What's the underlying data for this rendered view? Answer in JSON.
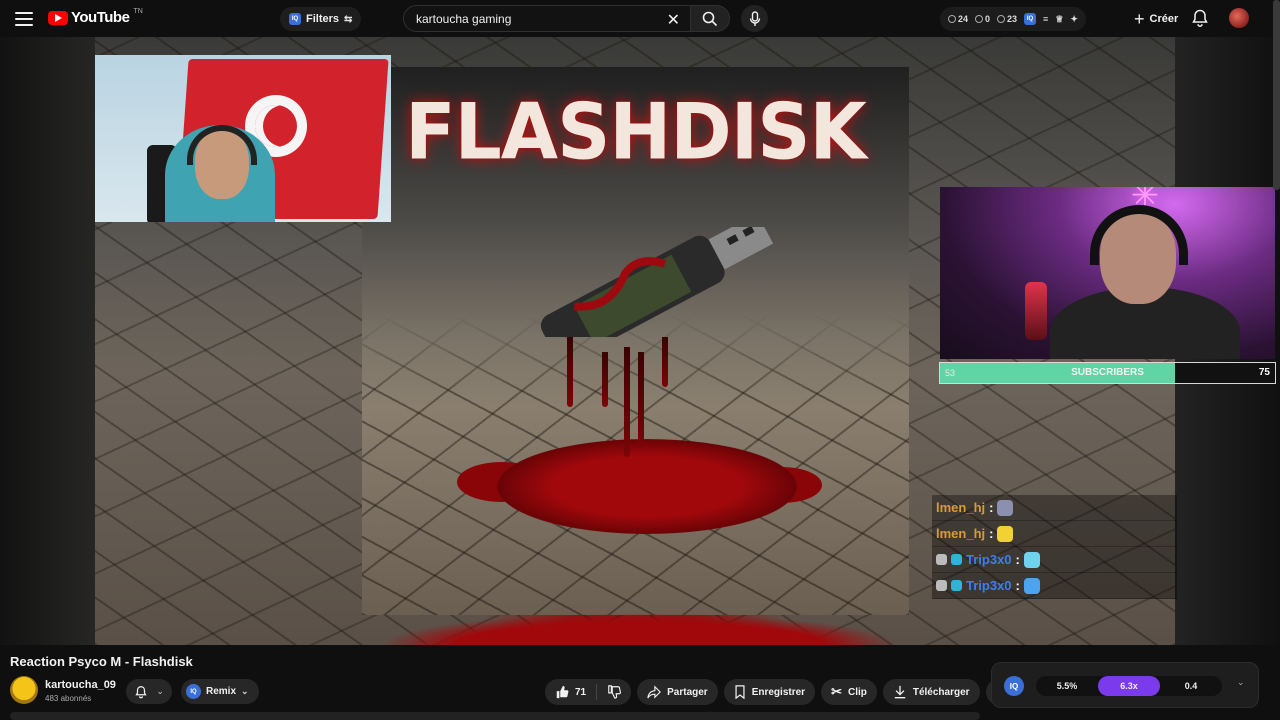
{
  "header": {
    "logo_text": "YouTube",
    "logo_sup": "TN",
    "filters_label": "Filters",
    "iq_label": "IQ",
    "search_value": "kartoucha gaming",
    "stats": [
      "24",
      "0",
      "23"
    ],
    "create_label": "Créer"
  },
  "video": {
    "cover_title": "FLASHDISK",
    "subscriber_bar": {
      "label": "SUBSCRIBERS",
      "min": "53",
      "max": "75",
      "fill_fraction": 0.7,
      "fill_color": "#5fd4a4"
    },
    "chat": [
      {
        "user": "lmen_hj",
        "color": "#d89b3a",
        "emote_color": "#8b8fb0",
        "badges": []
      },
      {
        "user": "lmen_hj",
        "color": "#d89b3a",
        "emote_color": "#f0d234",
        "badges": []
      },
      {
        "user": "Trip3x0",
        "color": "#3a7ff0",
        "emote_color": "#6fd3f0",
        "badges": [
          "#bcbcbc",
          "#2fb4d4"
        ]
      },
      {
        "user": "Trip3x0",
        "color": "#3a7ff0",
        "emote_color": "#4aa4ef",
        "badges": [
          "#bcbcbc",
          "#2fb4d4"
        ]
      }
    ]
  },
  "info": {
    "title": "Reaction Psyco M - Flashdisk",
    "channel_name": "kartoucha_09",
    "channel_subs": "483 abonnés",
    "remix_label": "Remix",
    "likes": "71",
    "share_label": "Partager",
    "save_label": "Enregistrer",
    "clip_label": "Clip",
    "download_label": "Télécharger"
  },
  "speed": {
    "iq_label": "IQ",
    "options": [
      "5.5%",
      "6.3x",
      "0.4"
    ],
    "active_index": 1,
    "accent": "#7c3aed"
  }
}
